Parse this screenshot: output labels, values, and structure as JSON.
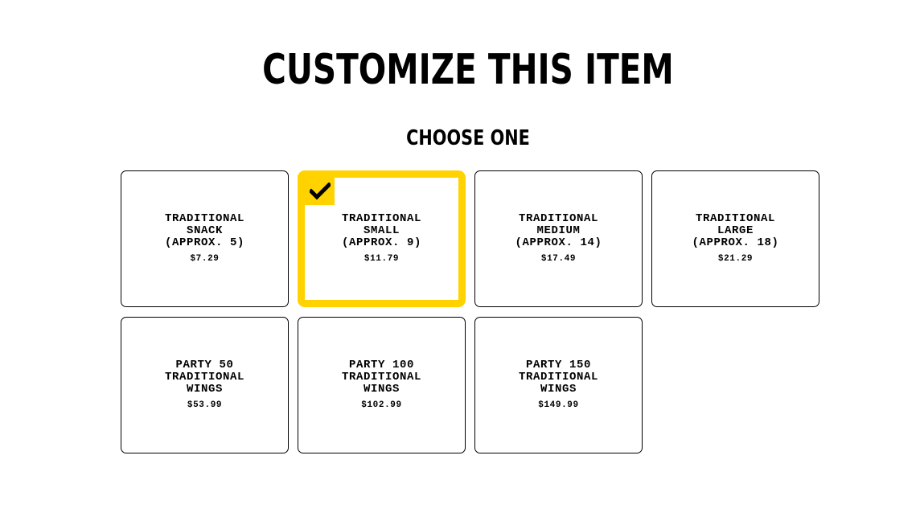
{
  "header": {
    "title": "CUSTOMIZE THIS ITEM"
  },
  "section": {
    "title": "CHOOSE ONE"
  },
  "colors": {
    "accent": "#ffd200",
    "border": "#000000",
    "text": "#000000",
    "background": "#ffffff"
  },
  "options": [
    {
      "name": "TRADITIONAL SNACK (APPROX. 5)",
      "price": "$7.29",
      "selected": false
    },
    {
      "name": "TRADITIONAL SMALL (APPROX. 9)",
      "price": "$11.79",
      "selected": true,
      "icon": "checkmark-icon"
    },
    {
      "name": "TRADITIONAL MEDIUM (APPROX. 14)",
      "price": "$17.49",
      "selected": false
    },
    {
      "name": "TRADITIONAL LARGE (APPROX. 18)",
      "price": "$21.29",
      "selected": false
    },
    {
      "name": "PARTY 50 TRADITIONAL WINGS",
      "price": "$53.99",
      "selected": false
    },
    {
      "name": "PARTY 100 TRADITIONAL WINGS",
      "price": "$102.99",
      "selected": false
    },
    {
      "name": "PARTY 150 TRADITIONAL WINGS",
      "price": "$149.99",
      "selected": false
    }
  ]
}
